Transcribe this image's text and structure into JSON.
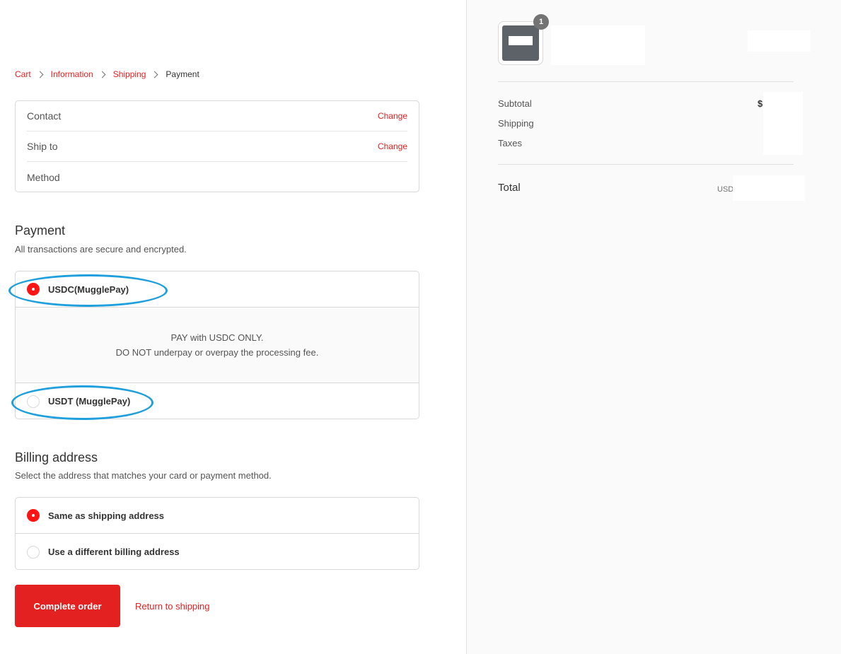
{
  "breadcrumb": {
    "items": [
      "Cart",
      "Information",
      "Shipping"
    ],
    "current": "Payment"
  },
  "review": {
    "contact_label": "Contact",
    "ship_to_label": "Ship to",
    "method_label": "Method",
    "change_label": "Change"
  },
  "payment": {
    "title": "Payment",
    "subtitle": "All transactions are secure and encrypted.",
    "options": [
      {
        "label": "USDC(MugglePay)",
        "selected": true
      },
      {
        "label": "USDT (MugglePay)",
        "selected": false
      }
    ],
    "detail_line1": "PAY with USDC ONLY.",
    "detail_line2": "DO NOT underpay or overpay the processing fee."
  },
  "billing": {
    "title": "Billing address",
    "subtitle": "Select the address that matches your card or payment method.",
    "options": [
      {
        "label": "Same as shipping address",
        "selected": true
      },
      {
        "label": "Use a different billing address",
        "selected": false
      }
    ]
  },
  "actions": {
    "complete_label": "Complete order",
    "return_label": "Return to shipping"
  },
  "summary": {
    "quantity_badge": "1",
    "subtotal_label": "Subtotal",
    "shipping_label": "Shipping",
    "taxes_label": "Taxes",
    "currency_symbol": "$",
    "total_label": "Total",
    "total_currency": "USD"
  },
  "colors": {
    "accent": "#e22120",
    "radio_selected": "#ff1414",
    "annotation": "#1fa0dc",
    "sidebar_bg": "#fafafa"
  }
}
